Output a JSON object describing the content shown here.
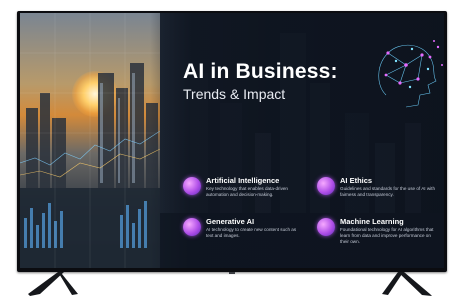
{
  "slide": {
    "title": "AI in Business:",
    "subtitle": "Trends & Impact"
  },
  "features": [
    {
      "title": "Artificial Intelligence",
      "description": "Key technology that enables data-driven automation and decision-making.",
      "icon": "ai-chip-icon"
    },
    {
      "title": "AI Ethics",
      "description": "Guidelines and standards for the use of AI with fairness and transparency.",
      "icon": "ethics-icon"
    },
    {
      "title": "Generative AI",
      "description": "AI technology to create new content such as text and images.",
      "icon": "generative-icon"
    },
    {
      "title": "Machine Learning",
      "description": "Foundational technology for AI algorithms that learn from data and improve performance on their own.",
      "icon": "machine-learning-icon"
    }
  ],
  "colors": {
    "accent": "#b04fe8",
    "background": "#0d1420",
    "title": "#ffffff"
  }
}
